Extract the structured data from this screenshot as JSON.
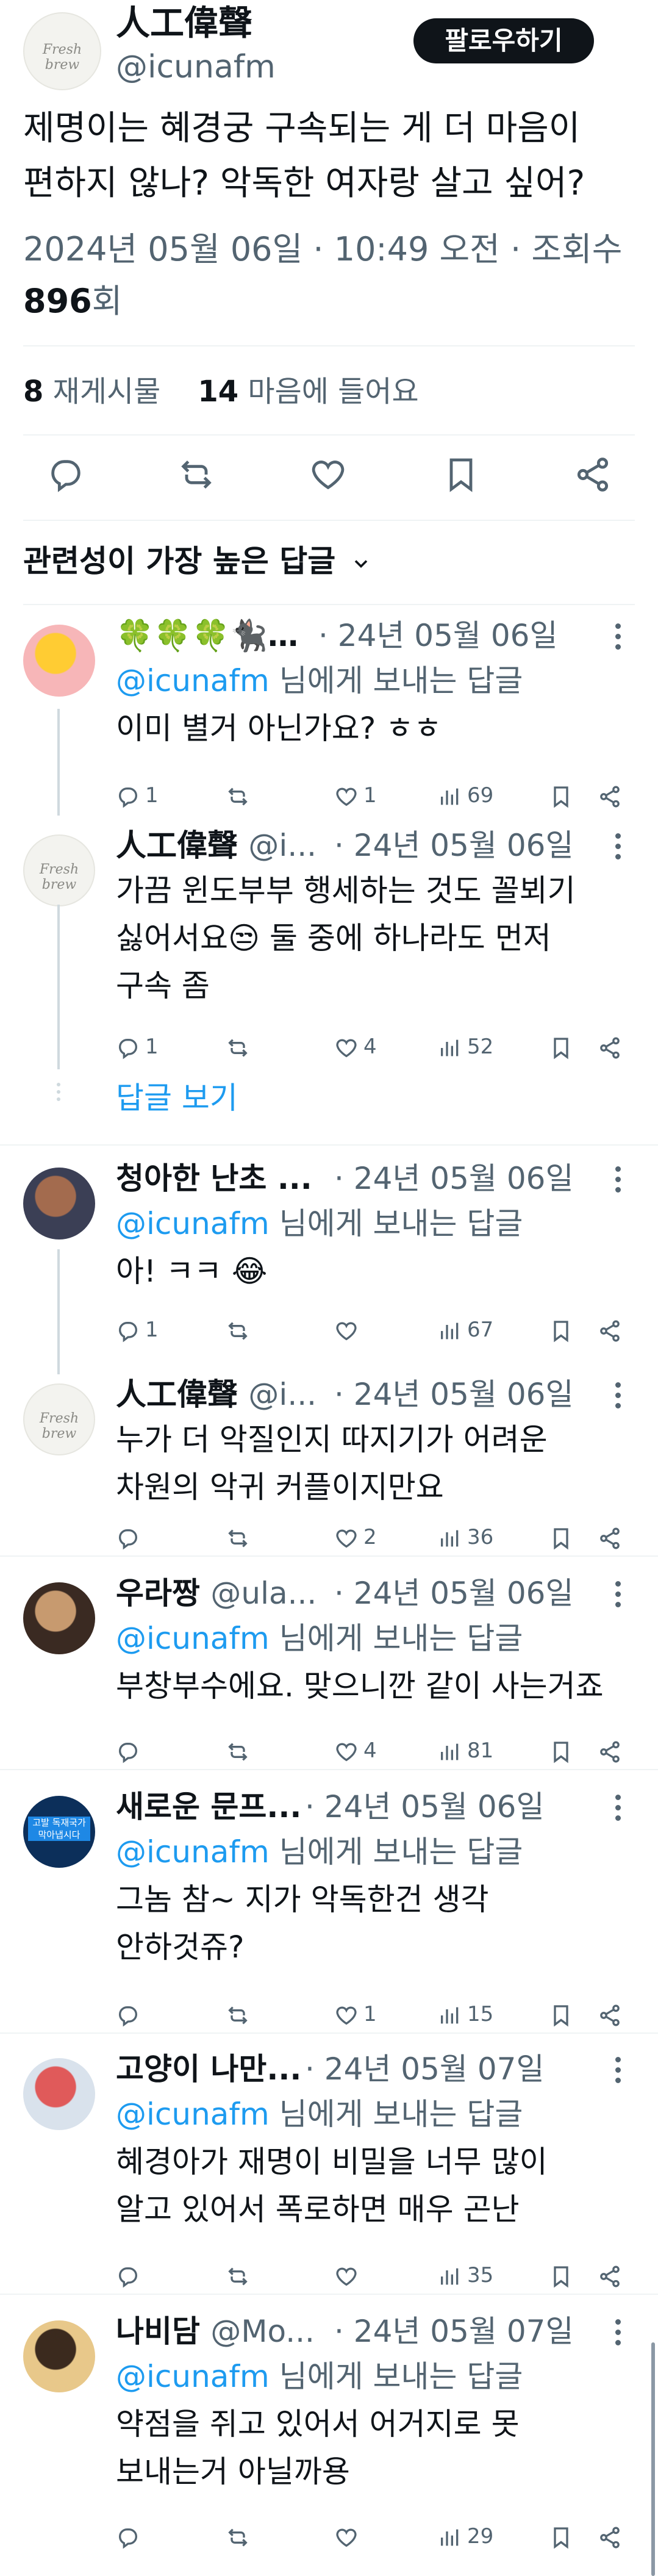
{
  "tweet": {
    "author_name": "人工偉聲",
    "author_handle": "@icunafm",
    "avatar_text": "Fresh brew",
    "follow_label": "팔로우하기",
    "text_line1": "제명이는 혜경궁 구속되는 게 더 마음이",
    "text_line2": "편하지 않나? 악독한 여자랑 살고 싶어?",
    "date_time": "2024년 05월 06일 · 10:49 오전 · 조회수",
    "views_count": "896",
    "views_suffix": "회",
    "retweets_count": "8",
    "retweets_label": "재게시물",
    "likes_count": "14",
    "likes_label": "마음에 들어요"
  },
  "actions": {
    "reply_icon": "reply-icon",
    "retweet_icon": "retweet-icon",
    "like_icon": "heart-icon",
    "bookmark_icon": "bookmark-icon",
    "share_icon": "share-icon"
  },
  "sort": {
    "label": "관련성이 가장 높은 답글"
  },
  "show_replies": "답글 보기",
  "replies": [
    {
      "name": "🍀🍀🍀🐈‍⬛…",
      "handle": "",
      "date": "· 24년 05월 06일",
      "replying_to": "@icunafm",
      "replying_suffix": " 님에게 보내는 답글",
      "lines": [
        "이미 별거 아닌가요? ㅎㅎ"
      ],
      "replies": "1",
      "retweets": "",
      "likes": "1",
      "views": "69"
    },
    {
      "name": "人工偉聲",
      "handle": "@i...",
      "date": "· 24년 05월 06일",
      "replying_to": "",
      "replying_suffix": "",
      "lines": [
        "가끔 윈도부부 행세하는 것도 꼴뵈기",
        "싫어서요😒 둘 중에 하나라도 먼저",
        "구속 좀"
      ],
      "replies": "1",
      "retweets": "",
      "likes": "4",
      "views": "52"
    },
    {
      "name": "청아한 난초 ...",
      "handle": "",
      "date": "· 24년 05월 06일",
      "replying_to": "@icunafm",
      "replying_suffix": " 님에게 보내는 답글",
      "lines": [
        "아!  ㅋㅋ 😂"
      ],
      "replies": "1",
      "retweets": "",
      "likes": "",
      "views": "67"
    },
    {
      "name": "人工偉聲",
      "handle": "@i...",
      "date": "· 24년 05월 06일",
      "replying_to": "",
      "replying_suffix": "",
      "lines": [
        "누가 더 악질인지 따지기가 어려운",
        "차원의 악귀 커플이지만요"
      ],
      "replies": "",
      "retweets": "",
      "likes": "2",
      "views": "36"
    },
    {
      "name": "우라짱",
      "handle": "@ula...",
      "date": "· 24년 05월 06일",
      "replying_to": "@icunafm",
      "replying_suffix": " 님에게 보내는 답글",
      "lines": [
        "부창부수에요. 맞으니깐 같이 사는거죠"
      ],
      "replies": "",
      "retweets": "",
      "likes": "4",
      "views": "81"
    },
    {
      "name": "새로운 문프...",
      "handle": "",
      "date": "· 24년 05월 06일",
      "replying_to": "@icunafm",
      "replying_suffix": " 님에게 보내는 답글",
      "lines": [
        "그놈 참~ 지가 악독한건 생각",
        "안하것쥬?"
      ],
      "replies": "",
      "retweets": "",
      "likes": "1",
      "views": "15",
      "avatar_text": "고발 독재국가 막아냅시다"
    },
    {
      "name": "고양이 나만...",
      "handle": "",
      "date": "· 24년 05월 07일",
      "replying_to": "@icunafm",
      "replying_suffix": " 님에게 보내는 답글",
      "lines": [
        "혜경아가 재명이 비밀을 너무 많이",
        "알고 있어서 폭로하면 매우 곤난"
      ],
      "replies": "",
      "retweets": "",
      "likes": "",
      "views": "35"
    },
    {
      "name": "나비담",
      "handle": "@Mo...",
      "date": "· 24년 05월 07일",
      "replying_to": "@icunafm",
      "replying_suffix": " 님에게 보내는 답글",
      "lines": [
        "약점을 쥐고 있어서 어거지로 못",
        "보내는거 아닐까용"
      ],
      "replies": "",
      "retweets": "",
      "likes": "",
      "views": "29"
    }
  ]
}
